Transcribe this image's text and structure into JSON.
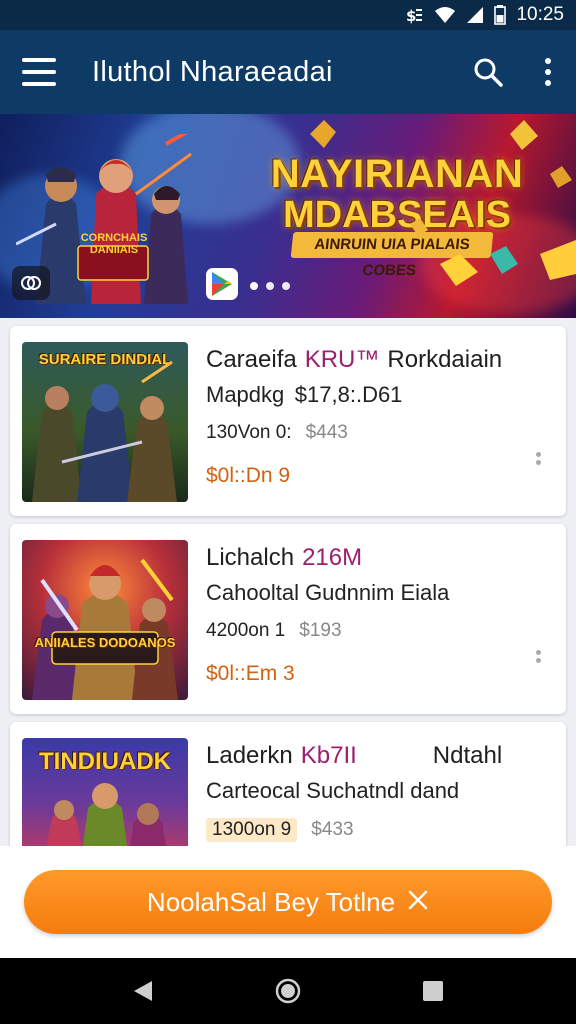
{
  "status_bar": {
    "time": "10:25"
  },
  "app_bar": {
    "title": "Iluthol Nharaeadai"
  },
  "banner": {
    "title_line1": "NAYIRIANAN",
    "title_line2": "MDABSEAIS",
    "tagline": "AINRUIN UIA PIALAIS COBES",
    "hero_label": "CORNCHAIS DANIIAIS",
    "page_count": 3,
    "active_page": 0
  },
  "games": [
    {
      "name": "Caraeifa",
      "highlight": "KRU™",
      "name_suffix": "Rorkdaiain",
      "subtitle": "Mapdkg  $17,8:.D61",
      "stat": "130Von 0:",
      "price": "$443",
      "sale": "$0l::Dn 9",
      "thumb_title": "SURAIRE DINDIAL"
    },
    {
      "name": "Lichalch",
      "highlight": "216M",
      "name_suffix": "",
      "subtitle": "Cahooltal Gudnnim Eiala",
      "stat": "4200on 1",
      "price": "$193",
      "sale": "$0l::Em 3",
      "thumb_title": "ANIIALES DODOANOS"
    },
    {
      "name": "Laderkn",
      "highlight": "Kb7II",
      "name_suffix": "Ndtahl",
      "subtitle": "Carteocal Suchatndl dand",
      "stat": "1300on 9",
      "price": "$433",
      "sale": "",
      "thumb_title": "TINDIUADK"
    }
  ],
  "cta": {
    "label": "NoolahSal Bey Totlne"
  },
  "colors": {
    "app_bar": "#0d3b66",
    "accent_orange": "#f57c0e",
    "highlight_purple": "#9b1f6c",
    "sale_orange": "#d4610f"
  }
}
